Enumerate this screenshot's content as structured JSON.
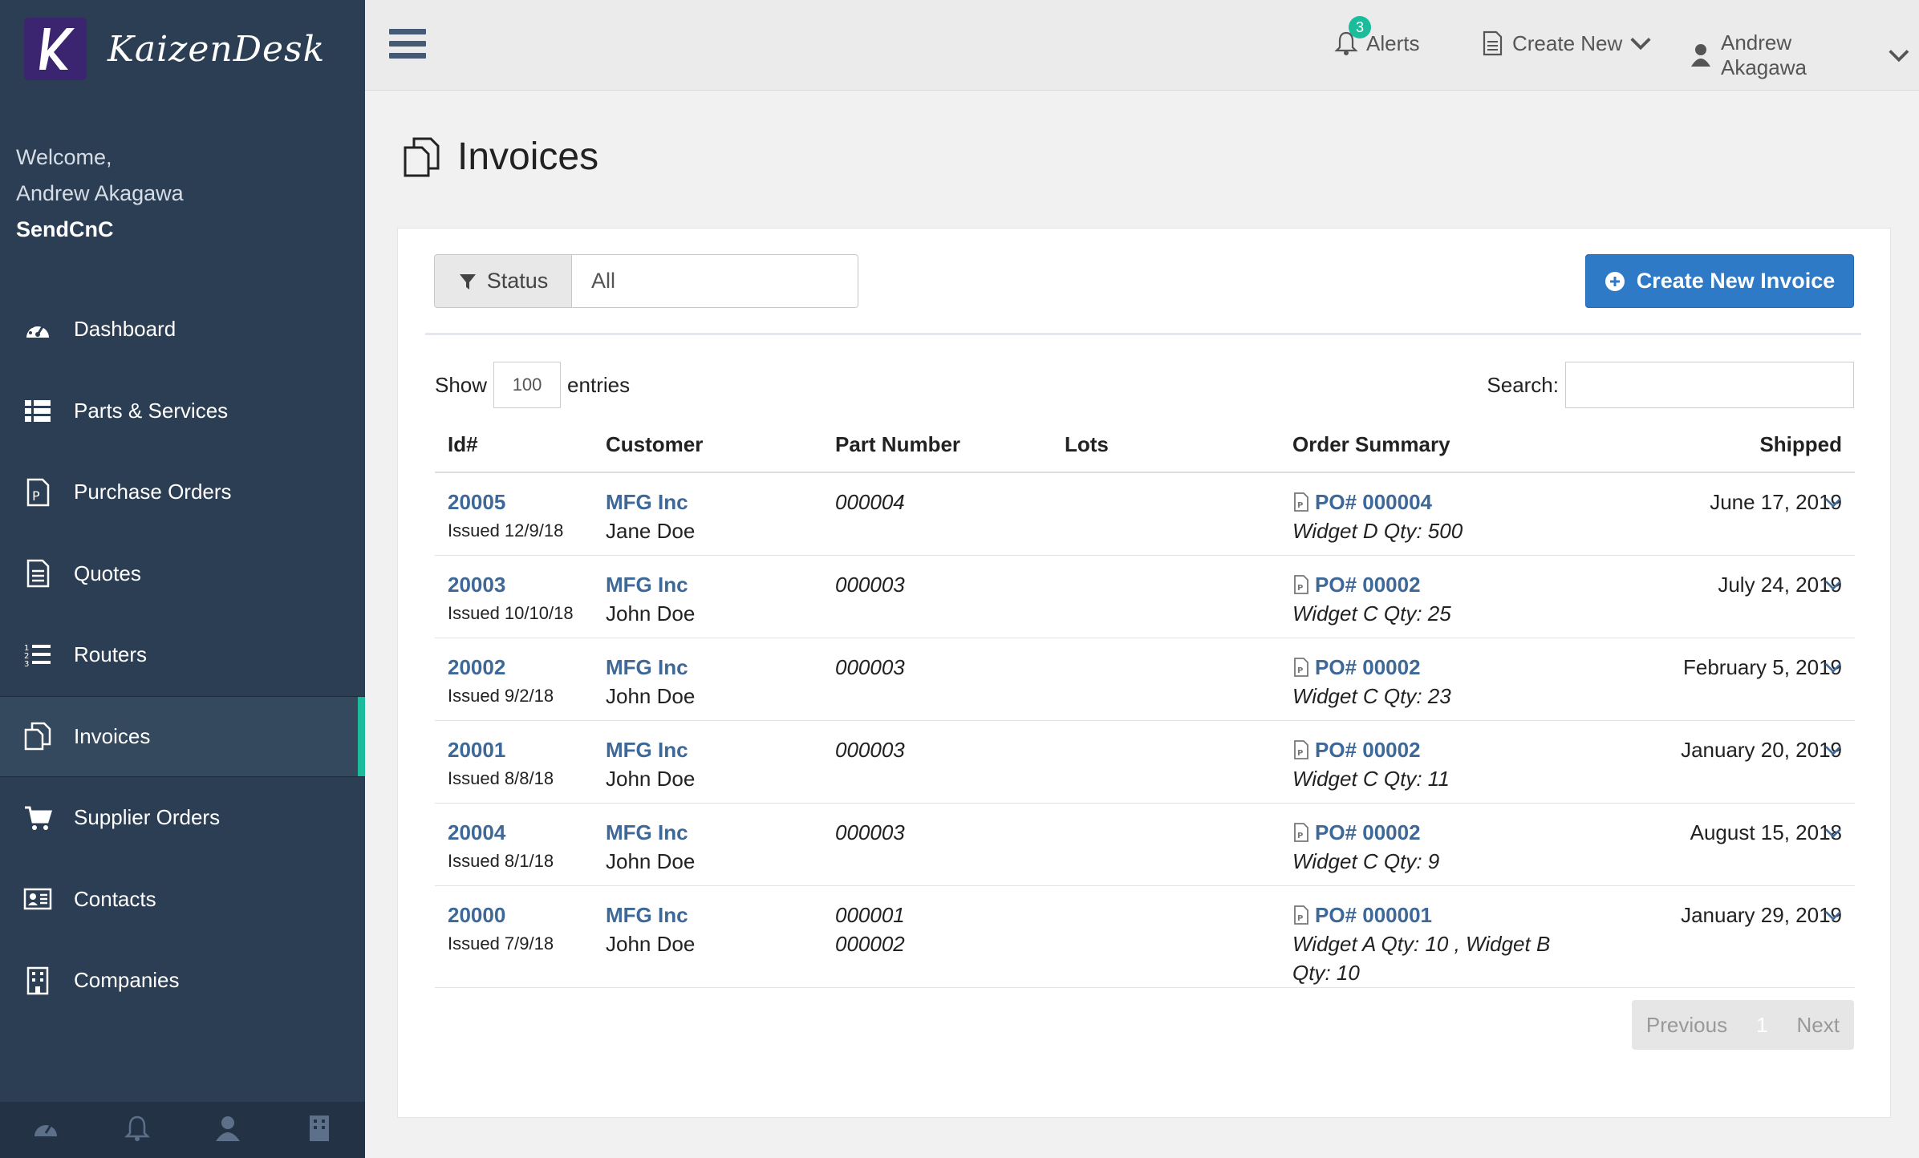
{
  "brand": {
    "name": "KaizenDesk"
  },
  "welcome": {
    "line1": "Welcome,",
    "user": "Andrew Akagawa",
    "company": "SendCnC"
  },
  "nav": {
    "items": [
      {
        "label": "Dashboard"
      },
      {
        "label": "Parts & Services"
      },
      {
        "label": "Purchase Orders"
      },
      {
        "label": "Quotes"
      },
      {
        "label": "Routers"
      },
      {
        "label": "Invoices"
      },
      {
        "label": "Supplier Orders"
      },
      {
        "label": "Contacts"
      },
      {
        "label": "Companies"
      }
    ]
  },
  "topbar": {
    "alerts_label": "Alerts",
    "alerts_count": "3",
    "create_new_label": "Create New",
    "user_label": "Andrew Akagawa"
  },
  "page": {
    "title": "Invoices"
  },
  "filter": {
    "status_label": "Status",
    "status_value": "All"
  },
  "actions": {
    "create_invoice": "Create New Invoice"
  },
  "table_controls": {
    "show": "Show",
    "entries_value": "100",
    "entries": "entries",
    "search_label": "Search:"
  },
  "columns": [
    "Id#",
    "Customer",
    "Part Number",
    "Lots",
    "Order Summary",
    "Shipped"
  ],
  "rows": [
    {
      "id": "20005",
      "issued": "Issued 12/9/18",
      "customer": "MFG Inc",
      "contact": "Jane Doe",
      "parts": [
        "000004"
      ],
      "lots": "",
      "po": "PO# 000004",
      "summary": "Widget D Qty: 500",
      "shipped": "June 17, 2019"
    },
    {
      "id": "20003",
      "issued": "Issued 10/10/18",
      "customer": "MFG Inc",
      "contact": "John Doe",
      "parts": [
        "000003"
      ],
      "lots": "",
      "po": "PO# 00002",
      "summary": "Widget C Qty: 25",
      "shipped": "July 24, 2019"
    },
    {
      "id": "20002",
      "issued": "Issued 9/2/18",
      "customer": "MFG Inc",
      "contact": "John Doe",
      "parts": [
        "000003"
      ],
      "lots": "",
      "po": "PO# 00002",
      "summary": "Widget C Qty: 23",
      "shipped": "February 5, 2019"
    },
    {
      "id": "20001",
      "issued": "Issued 8/8/18",
      "customer": "MFG Inc",
      "contact": "John Doe",
      "parts": [
        "000003"
      ],
      "lots": "",
      "po": "PO# 00002",
      "summary": "Widget C Qty: 11",
      "shipped": "January 20, 2019"
    },
    {
      "id": "20004",
      "issued": "Issued 8/1/18",
      "customer": "MFG Inc",
      "contact": "John Doe",
      "parts": [
        "000003"
      ],
      "lots": "",
      "po": "PO# 00002",
      "summary": "Widget C Qty: 9",
      "shipped": "August 15, 2018"
    },
    {
      "id": "20000",
      "issued": "Issued 7/9/18",
      "customer": "MFG Inc",
      "contact": "John Doe",
      "parts": [
        "000001",
        "000002"
      ],
      "lots": "",
      "po": "PO# 000001",
      "summary": "Widget A Qty: 10 , Widget B Qty: 10",
      "shipped": "January 29, 2019"
    }
  ],
  "pagination": {
    "previous": "Previous",
    "page": "1",
    "next": "Next"
  },
  "colors": {
    "sidebar": "#2c3e54",
    "accent": "#1abc9c",
    "primary": "#2e7ac7",
    "link": "#3d6897"
  }
}
